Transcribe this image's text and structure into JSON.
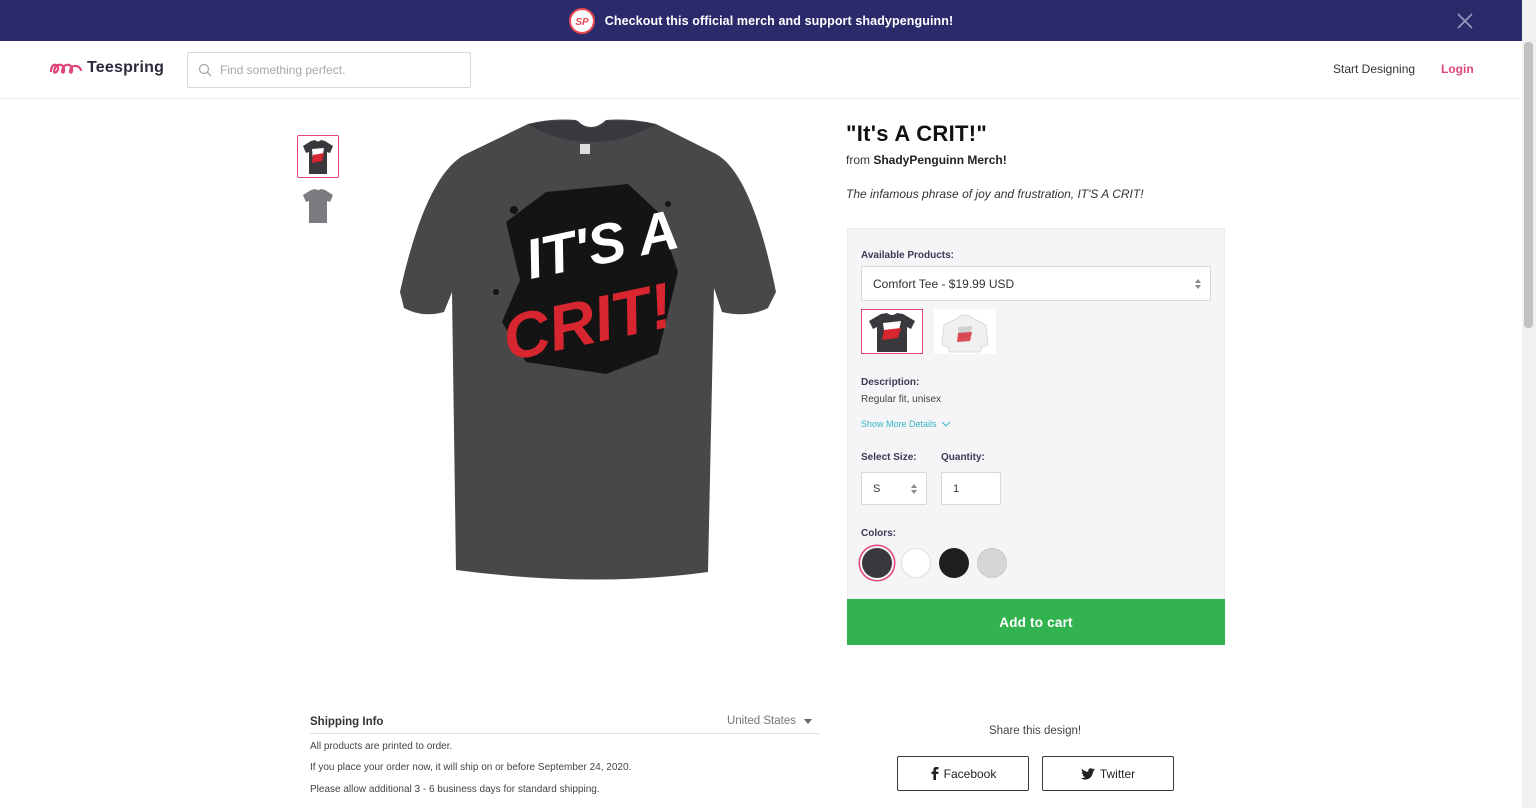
{
  "banner": {
    "logo_text": "SP",
    "text": "Checkout this official merch and support shadypenguinn!"
  },
  "header": {
    "brand": "Teespring",
    "search_placeholder": "Find something perfect.",
    "start_designing": "Start Designing",
    "login": "Login"
  },
  "product": {
    "title": "\"It's A CRIT!\"",
    "from_prefix": "from",
    "store": "ShadyPenguinn Merch!",
    "tagline": "The infamous phrase of joy and frustration, IT'S A CRIT!",
    "design_text_top": "IT'S A",
    "design_text_bottom": "CRIT!",
    "available_label": "Available Products:",
    "selected_product": "Comfort Tee - $19.99 USD",
    "description_label": "Description:",
    "description": "Regular fit, unisex",
    "show_more": "Show More Details",
    "size_label": "Select Size:",
    "size_value": "S",
    "quantity_label": "Quantity:",
    "quantity_value": "1",
    "colors_label": "Colors:",
    "colors": [
      "#3a383c",
      "#ffffff",
      "#1e1e20",
      "#d6d6d8"
    ],
    "add_to_cart": "Add to cart"
  },
  "shipping": {
    "title": "Shipping Info",
    "country": "United States",
    "lines": [
      "All products are printed to order.",
      "If you place your order now, it will ship on or before September 24, 2020.",
      "Please allow additional 3 - 6 business days for standard shipping."
    ]
  },
  "share": {
    "title": "Share this design!",
    "facebook": "Facebook",
    "twitter": "Twitter"
  },
  "colors": {
    "banner_bg": "#2b2a6b",
    "accent_pink": "#e0457b",
    "cart_green": "#32b350",
    "shirt": "#4a474b",
    "design_red": "#d7262f"
  }
}
